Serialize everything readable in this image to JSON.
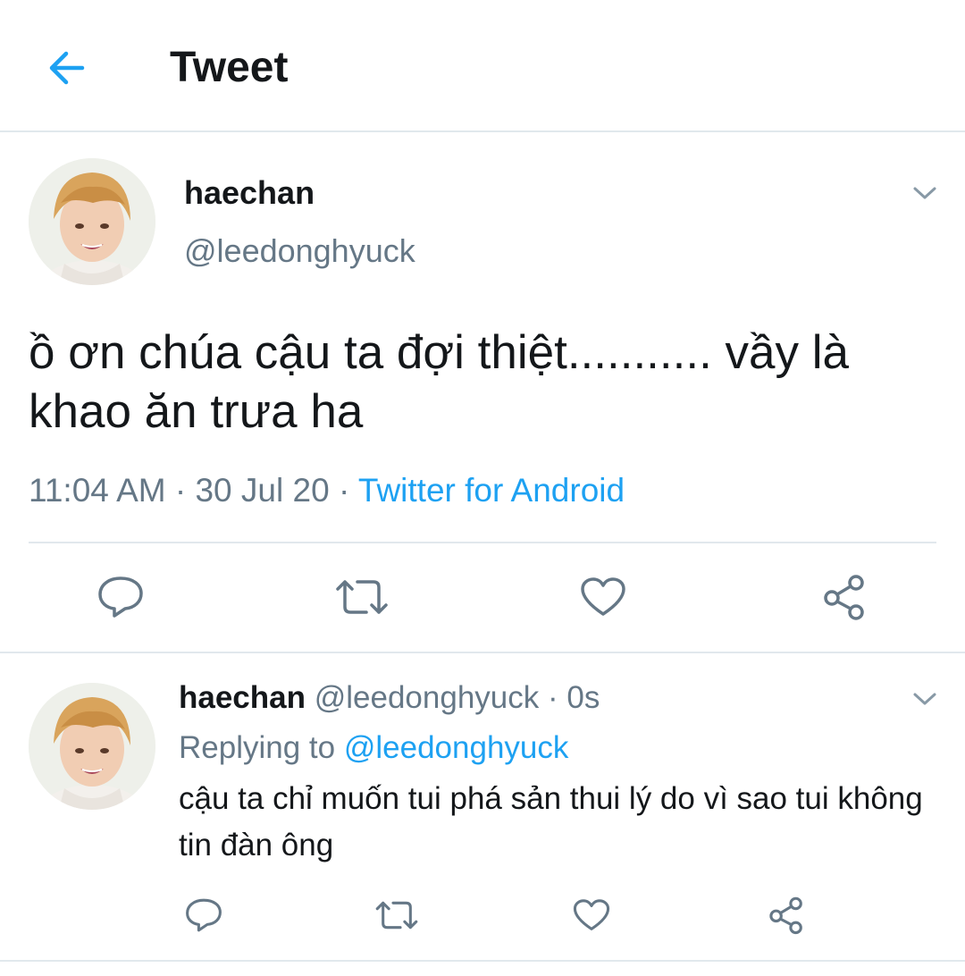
{
  "header": {
    "title": "Tweet",
    "back_icon": "arrow-left-icon"
  },
  "colors": {
    "accent": "#1da1f2",
    "secondary_text": "#657786",
    "divider": "#e1e8ed",
    "primary_text": "#14171a"
  },
  "main_tweet": {
    "name": "haechan",
    "handle": "@leedonghyuck",
    "text": "ồ ơn chúa cậu ta đợi thiệt........... vầy là khao ăn trưa ha",
    "time": "11:04 AM",
    "date": "30 Jul 20",
    "source": "Twitter for Android",
    "separator": "·",
    "actions": [
      "reply-icon",
      "retweet-icon",
      "like-icon",
      "share-icon"
    ]
  },
  "reply_tweet": {
    "name": "haechan",
    "handle": "@leedonghyuck",
    "age": "0s",
    "separator": "·",
    "replying_label": "Replying to",
    "replying_to": "@leedonghyuck",
    "text": "cậu ta chỉ muốn tui phá sản thui lý do vì sao tui không tin đàn ông",
    "actions": [
      "reply-icon",
      "retweet-icon",
      "like-icon",
      "share-icon"
    ]
  }
}
